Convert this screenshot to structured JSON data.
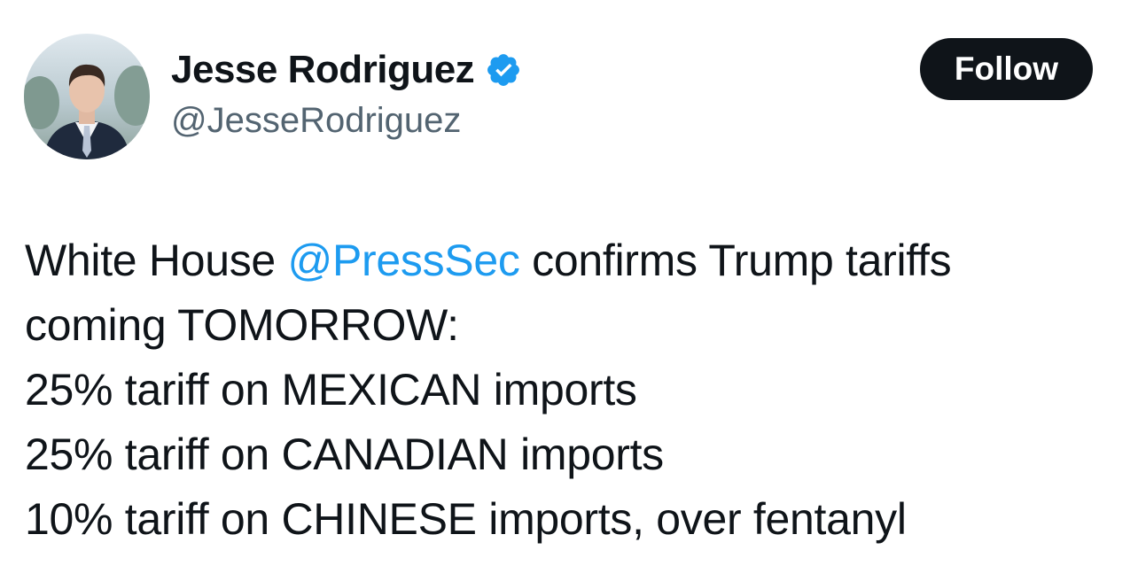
{
  "author": {
    "display_name": "Jesse Rodriguez",
    "handle": "@JesseRodriguez",
    "verified": true,
    "avatar_icon": "profile-photo"
  },
  "follow_button": {
    "label": "Follow"
  },
  "tweet": {
    "line1": {
      "before": "White House ",
      "mention": "@PressSec",
      "after": " confirms Trump tariffs"
    },
    "line2": "coming TOMORROW:",
    "line3": "25% tariff on MEXICAN imports",
    "line4": "25% tariff on CANADIAN imports",
    "line5": "10% tariff on CHINESE imports, over fentanyl"
  },
  "colors": {
    "text_primary": "#0f1419",
    "text_secondary": "#536471",
    "link": "#1d9bf0",
    "verified_badge": "#1d9bf0",
    "button_bg": "#0f1419",
    "button_text": "#ffffff"
  }
}
